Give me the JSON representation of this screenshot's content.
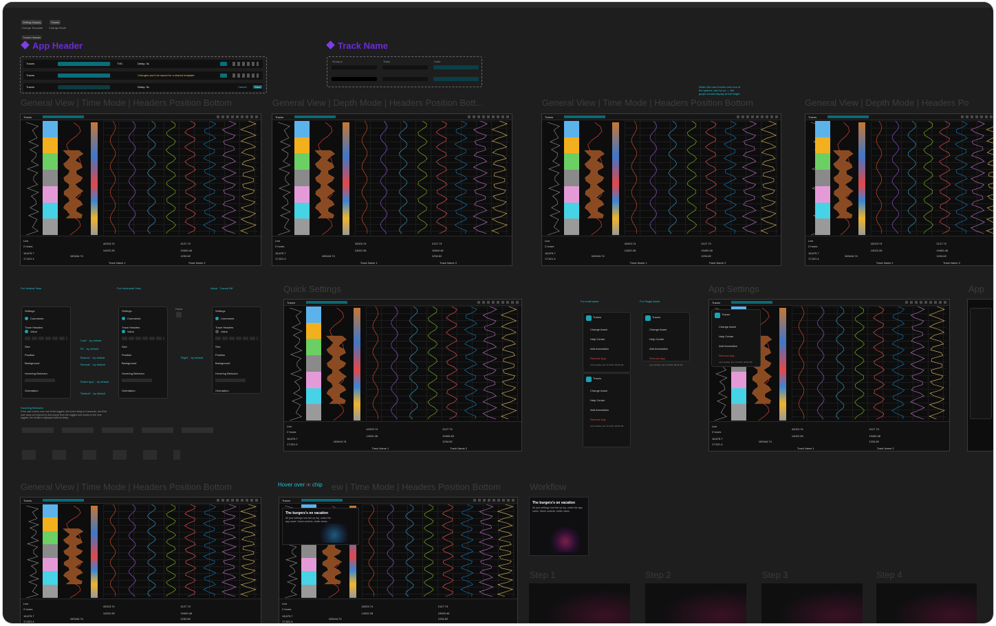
{
  "top_chips": {
    "chip1": "Drilling Display",
    "chip1_sub": "Change Template",
    "chip2": "Traces",
    "chip2_sub": "Change Mode",
    "chip3": "Traces Header"
  },
  "headers": {
    "app_header": "App Header",
    "track_name": "Track Name",
    "row_label": "Traces",
    "template": "Template: Drilling Display",
    "tvd": "TVD",
    "delay": "Delay: 3s",
    "row2_note": "Changes won't be saved for a shared template",
    "row3_btn": "Cancel",
    "row3_save": "Save"
  },
  "track_name_box": {
    "field1": "Group A",
    "field2": "Track",
    "field3": "Color",
    "name1": "Track Name 1",
    "name2": "Track Name 2"
  },
  "row1_titles": [
    "General View | Time Mode | Headers Position Bottom",
    "General View | Depth Mode | Headers Position Bott...",
    "General View | Time Mode | Headers Position Bottom",
    "General View | Depth Mode | Headers Po"
  ],
  "row1_note": "When the user hovers over one of the options, and so on — the graph should display at full height",
  "thumb_footer": {
    "live": "Live",
    "window": "2 hours",
    "value1": "18,675.7",
    "value2": "17,521.4",
    "metric_a": "42023.74",
    "metric_b": "2127.73",
    "metric_c": "14022.28",
    "metric_d": "19400.46",
    "metric_e": "1234.62",
    "metric_f": "163444.74",
    "track_a": "Track Name 1",
    "track_b": "Track Name 2"
  },
  "row2": {
    "label_left1": "For Vertical View",
    "label_left2": "For Horizontal View",
    "label_value": "Value · Turned Off",
    "quick_settings": "Quick Settings",
    "app_settings": "App Settings",
    "label_multi_asset": "For multi asset",
    "label_single_asset": "For Single Asset",
    "hovering_title": "Hovering Behavior",
    "hovering_desc": "If the user hovers over one of the toggles, the hover delay is 3 seconds, but if the user does not respond to the mouse from the toggles and moves to the next toggles, the tooltip is displayed without delay.",
    "app_title": "App"
  },
  "settings_panel": {
    "title": "Settings",
    "comments": "Comments",
    "trace_headers": "Trace Headers",
    "value": "Value",
    "size": "Size",
    "position": "Position",
    "background": "Background",
    "hovering_behavior": "Hovering Behavior",
    "orientation": "Orientation",
    "notes": [
      "\"Last\" - by default",
      "\"M\" - by default",
      "\"Bottom\" - by default",
      "\"Normal\" - by default",
      "\"Entire App\" - by default",
      "\"Vertical\" - by default"
    ],
    "right_note": "\"Right\" - by default",
    "hover": "Hover"
  },
  "app_settings_menu": {
    "traces": "Traces",
    "change_asset": "Change Asset",
    "help_center": "Help Center",
    "add_annotation": "Add Annotation",
    "remove_app": "Remove App",
    "last_update": "Last Update: Apr 15 2023, 08:30 AM",
    "trace_list": "Traces list"
  },
  "row3": {
    "title1": "General View | Time Mode | Headers Position Bottom",
    "hover_prefix": "Hover over",
    "hover_chip": "chip",
    "title2_rest": "ew | Time Mode | Headers Position Bottom",
    "workflow": "Workflow",
    "burger_title": "The burgers's on vacation",
    "burger_desc": "All your settings now live up top, under the app name. Same controls, better views.",
    "steps": [
      "Step 1",
      "Step 2",
      "Step 3",
      "Step 4"
    ]
  },
  "colors": {
    "accent_purple": "#6c2bd9",
    "cyan": "#1ec3d6",
    "bg": "#1e1e1e"
  }
}
